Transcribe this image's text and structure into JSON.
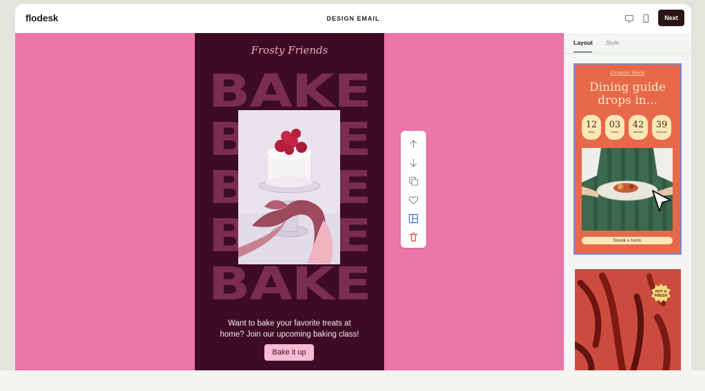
{
  "app": {
    "logo": "flodesk",
    "title": "DESIGN EMAIL",
    "next_label": "Next"
  },
  "topbar": {
    "icons": [
      "desktop-icon",
      "mobile-icon"
    ]
  },
  "email": {
    "script_title": "Frosty Friends",
    "bake_words": [
      "BAKE",
      "BAKE",
      "BAKE",
      "BAKE",
      "BAKE"
    ],
    "body_line1": "Want to bake your favorite treats at",
    "body_line2": "home? Join our upcoming baking class!",
    "cta_label": "Bake it up",
    "colors": {
      "canvas_bg": "#ec76a8",
      "email_bg": "#3d0c24",
      "bake_text": "#7a2c52",
      "cta_bg": "#f7bcd3"
    }
  },
  "block_toolbar": {
    "icons": [
      "arrow-up-icon",
      "arrow-down-icon",
      "duplicate-icon",
      "heart-icon",
      "layout-icon",
      "trash-icon"
    ]
  },
  "panel": {
    "tabs": [
      {
        "label": "Layout",
        "active": true
      },
      {
        "label": "Style",
        "active": false
      }
    ],
    "templates": [
      {
        "small_label": "Organic Feels",
        "headline_1": "Dining guide",
        "headline_2": "drops in...",
        "countdown": [
          {
            "value": "12",
            "label": "Days"
          },
          {
            "value": "03",
            "label": "Hours"
          },
          {
            "value": "42",
            "label": "Minutes"
          },
          {
            "value": "39",
            "label": "Seconds"
          }
        ],
        "cta_label": "Sneak a taste",
        "selected": true
      },
      {
        "badge_line1": "HOT &",
        "badge_line2": "FRESH"
      }
    ]
  }
}
